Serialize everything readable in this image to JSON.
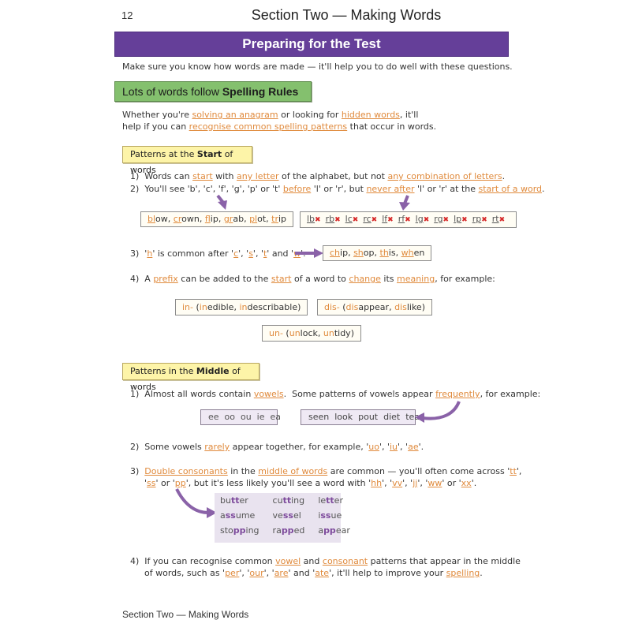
{
  "header": {
    "page_number": "12",
    "running_title": "Section Two — Making Words"
  },
  "title": "Preparing for the Test",
  "intro": "Make sure you know how words are made — it'll help you to do well with these questions.",
  "section_heading": {
    "plain": "Lots of words follow ",
    "bold": "Spelling Rules"
  },
  "lead": {
    "t1": "Whether you're ",
    "l1": "solving an anagram",
    "t2": " or looking for ",
    "l2": "hidden words",
    "t3": ", it'll",
    "t4": "help if you can ",
    "l3": "recognise common spelling patterns",
    "t5": " that occur in words."
  },
  "start_box": {
    "pre": "Patterns at the ",
    "bold": "Start",
    "post": " of words"
  },
  "start_points": {
    "p1": {
      "num": "1)",
      "a": "Words can ",
      "l1": "start",
      "b": " with ",
      "l2": "any letter",
      "c": " of the alphabet, but not ",
      "l3": "any combination of letters",
      "d": "."
    },
    "p2": {
      "num": "2)",
      "a": "You'll see 'b', 'c', 'f', 'g', 'p' or 't' ",
      "l1": "before",
      "b": " 'l' or 'r', but ",
      "l2": "never after",
      "c": " 'l' or 'r' at the ",
      "l3": "start of a word",
      "d": "."
    },
    "p3": {
      "num": "3)",
      "q1": "h",
      "a": "' is common after '",
      "q2": "c",
      "q3": "s",
      "q4": "t",
      "q5": "w",
      "and": " and "
    },
    "p4": {
      "num": "4)",
      "a": "A ",
      "l1": "prefix",
      "b": " can be added to the ",
      "l2": "start",
      "c": " of a word to ",
      "l3": "change",
      "d": " its ",
      "l4": "meaning",
      "e": ", for example:"
    }
  },
  "allowed_words": [
    {
      "hl": "bl",
      "rest": "ow"
    },
    {
      "hl": "cr",
      "rest": "own"
    },
    {
      "hl": "fl",
      "rest": "ip"
    },
    {
      "hl": "gr",
      "rest": "ab"
    },
    {
      "hl": "pl",
      "rest": "ot"
    },
    {
      "hl": "tr",
      "rest": "ip"
    }
  ],
  "forbidden_pairs": [
    "lb",
    "rb",
    "lc",
    "rc",
    "lf",
    "rf",
    "lg",
    "rg",
    "lp",
    "rp",
    "rt"
  ],
  "h_words": [
    {
      "hl": "ch",
      "rest": "ip"
    },
    {
      "hl": "sh",
      "rest": "op"
    },
    {
      "hl": "th",
      "rest": "is"
    },
    {
      "hl": "wh",
      "rest": "en"
    }
  ],
  "prefixes": {
    "in": {
      "prefix": "in-",
      "open": " (",
      "w1hl": "in",
      "w1": "edible, ",
      "w2hl": "in",
      "w2": "describable)"
    },
    "dis": {
      "prefix": "dis-",
      "open": " (",
      "w1hl": "dis",
      "w1": "appear, ",
      "w2hl": "dis",
      "w2": "like)"
    },
    "un": {
      "prefix": "un-",
      "open": " (",
      "w1hl": "un",
      "w1": "lock, ",
      "w2hl": "un",
      "w2": "tidy)"
    }
  },
  "middle_box": {
    "pre": "Patterns in the ",
    "bold": "Middle",
    "post": " of words"
  },
  "middle_points": {
    "p1": {
      "num": "1)",
      "a": "Almost all words contain ",
      "l1": "vowels",
      "b": ".  Some patterns of vowels appear ",
      "l2": "frequently",
      "c": ", for example:"
    },
    "p2": {
      "num": "2)",
      "a": "Some vowels ",
      "l1": "rarely",
      "b": " appear together, for example, '",
      "q1": "uo",
      "q2": "iu",
      "q3": "ae"
    },
    "p3": {
      "num": "3)",
      "l1": "Double consonants",
      "a": " in the ",
      "l2": "middle of words",
      "b": " are common — you'll often come across '",
      "q1": "tt",
      "c": "'",
      "q2": "ss",
      "d": "' or '",
      "q3": "pp",
      "e": "', but it's less likely you'll see a word with '",
      "q4": "hh",
      "q5": "vv",
      "q6": "jj",
      "q7": "ww",
      "q8": "xx"
    },
    "p4": {
      "num": "4)",
      "a": "If you can recognise common ",
      "l1": "vowel",
      "b": " and ",
      "l2": "consonant",
      "c": " patterns that appear in the middle",
      "d": "of words, such as '",
      "q1": "per",
      "q2": "our",
      "q3": "are",
      "q4": "ate",
      "e": "', it'll help to improve your ",
      "l3": "spelling",
      "f": "."
    }
  },
  "vowel_patterns": "ee  oo  ou  ie  ea",
  "vowel_words": "seen  look  pout  diet  tear",
  "double_words": [
    [
      {
        "a": "bu",
        "b": "tt",
        "c": "er"
      },
      {
        "a": "cu",
        "b": "tt",
        "c": "ing"
      },
      {
        "a": "le",
        "b": "tt",
        "c": "er"
      }
    ],
    [
      {
        "a": "a",
        "b": "ss",
        "c": "ume"
      },
      {
        "a": "ve",
        "b": "ss",
        "c": "el"
      },
      {
        "a": "i",
        "b": "ss",
        "c": "ue"
      }
    ],
    [
      {
        "a": "sto",
        "b": "pp",
        "c": "ing"
      },
      {
        "a": "ra",
        "b": "pp",
        "c": "ed"
      },
      {
        "a": "a",
        "b": "pp",
        "c": "ear"
      }
    ]
  ],
  "footer": "Section Two — Making Words",
  "colors": {
    "title_bar": "#653f99",
    "heading_green": "#84c06e",
    "box_yellow": "#fdf4a8",
    "link_orange": "#e08a3c",
    "arrow_purple": "#8a62a8",
    "cross_red": "#d62828"
  }
}
